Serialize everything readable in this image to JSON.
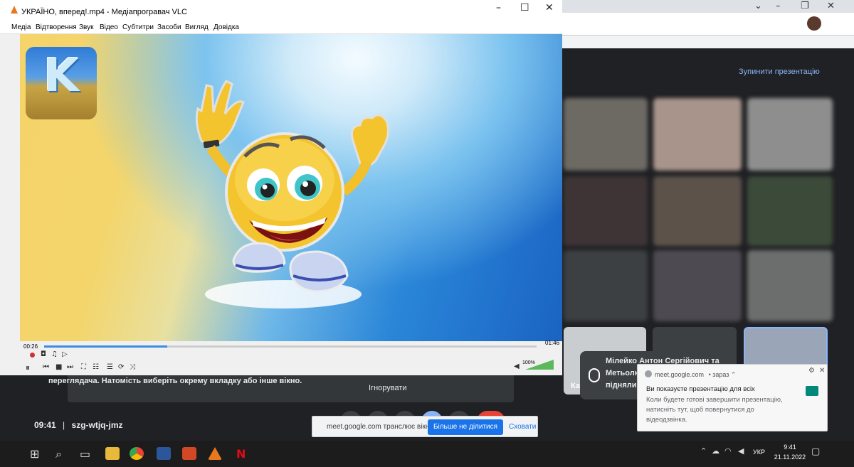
{
  "vlc": {
    "title": "УКРАЇНО, вперед!.mp4 - Медіапрогравач VLC",
    "menu": [
      "Медіа",
      "Відтворення",
      "Звук",
      "Відео",
      "Субтитри",
      "Засоби",
      "Вигляд",
      "Довідка"
    ],
    "elapsed": "00:26",
    "total": "01:46",
    "volume": "100%",
    "progress_fraction": 0.25,
    "logo_letter": "K"
  },
  "meet": {
    "stop_presentation": "Зупинити презентацію",
    "presenting_text": "переглядача. Натомість виберіть окрему вкладку або інше вікно.",
    "ignore": "Ігнорувати",
    "meeting_time": "09:41",
    "separator": "|",
    "meeting_code": "szg-wtjq-jmz",
    "raised_hand_1": "Мілейко Антон Сергійович та",
    "raised_hand_2": "Метьолк",
    "raised_hand_3": "підняли",
    "tile_label": "Ка"
  },
  "sharebar": {
    "message": "meet.google.com транслює вікно.",
    "stop_button": "Більше не ділитися",
    "hide_button": "Сховати"
  },
  "notification": {
    "source": "meet.google.com",
    "time": "• зараз ⌃",
    "title": "Ви показуєте презентацію для всіх",
    "body": "Коли будете готові завершити презентацію, натисніть тут, щоб повернутися до відеодзвінка."
  },
  "taskbar": {
    "lang": "УКР",
    "time": "9:41",
    "date": "21.11.2022"
  },
  "colors": {
    "vlc_orange": "#e8781e",
    "meet_dark": "#202124",
    "google_blue": "#1a73e8",
    "link_blue": "#8ab4f8"
  }
}
